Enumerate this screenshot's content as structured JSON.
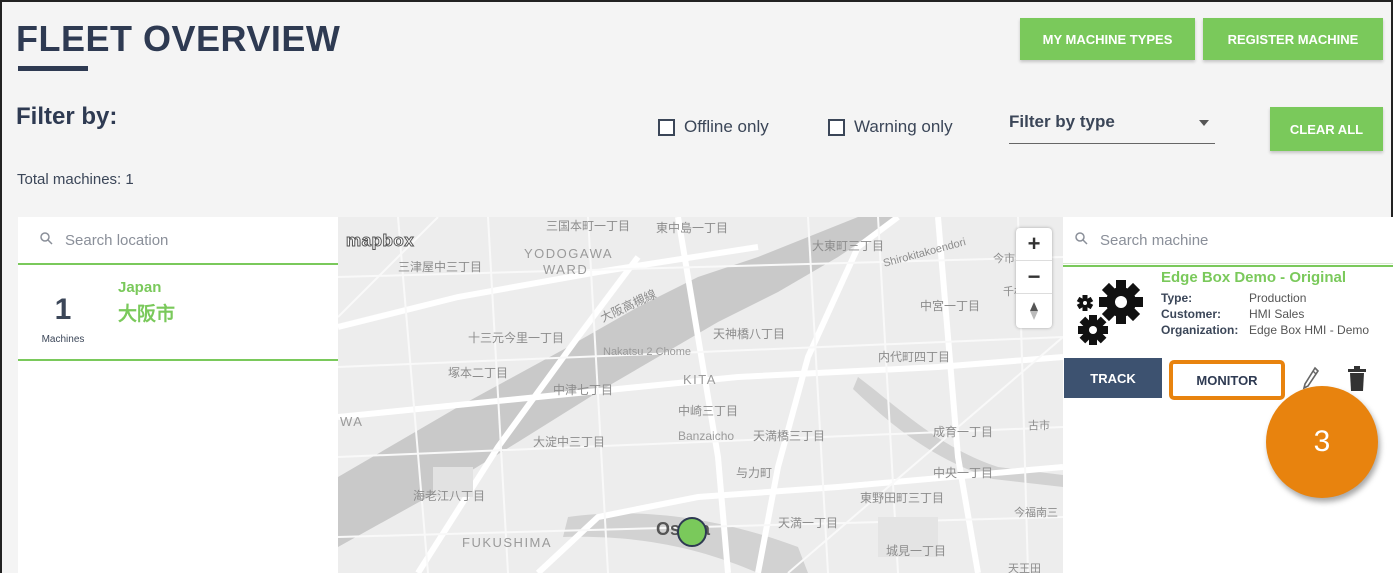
{
  "header": {
    "title": "FLEET OVERVIEW",
    "my_machine_types_label": "MY MACHINE TYPES",
    "register_machine_label": "REGISTER MACHINE"
  },
  "filters": {
    "heading": "Filter by:",
    "offline_only_label": "Offline only",
    "offline_only_checked": false,
    "warning_only_label": "Warning only",
    "warning_only_checked": false,
    "type_placeholder": "Filter by type",
    "clear_all_label": "CLEAR ALL"
  },
  "summary": {
    "total_machines": "Total machines: 1"
  },
  "location_panel": {
    "search_placeholder": "Search location",
    "items": [
      {
        "count": "1",
        "count_label": "Machines",
        "country": "Japan",
        "city": "大阪市"
      }
    ]
  },
  "map": {
    "provider_logo": "mapbox",
    "labels": [
      "三国本町一丁目",
      "東中島一丁目",
      "YODOGAWA",
      "WARD",
      "三津屋中三丁目",
      "大阪高槻線",
      "大東町三丁目",
      "Shirokitakoendori",
      "中宮一丁目",
      "十三元今里一丁目",
      "天神橋八丁目",
      "Nakatsu 2 Chome",
      "内代町四丁目",
      "塚本二丁目",
      "中津七丁目",
      "KITA",
      "中崎三丁目",
      "大淀中三丁目",
      "Banzaicho",
      "天満橋三丁目",
      "成育一丁目",
      "与力町",
      "中央一丁目",
      "海老江八丁目",
      "東野田町三丁目",
      "天満一丁目",
      "FUKUSHIMA",
      "城見一丁目",
      "Osaka",
      "WA",
      "今市",
      "古市",
      "今福南三",
      "天王田",
      "千林"
    ],
    "zoom_in_label": "+",
    "zoom_out_label": "−",
    "marker_status_color": "#7ac95b"
  },
  "machine_panel": {
    "search_placeholder": "Search machine",
    "machines": [
      {
        "name": "Edge Box Demo - Original",
        "type_key": "Type:",
        "type_value": "Production",
        "customer_key": "Customer:",
        "customer_value": "HMI Sales",
        "organization_key": "Organization:",
        "organization_value": "Edge Box HMI - Demo",
        "icon": "gears-icon",
        "track_label": "TRACK",
        "monitor_label": "MONITOR"
      }
    ]
  },
  "annotation": {
    "step_number": "3",
    "highlight_color": "#e8830e"
  },
  "colors": {
    "accent_green": "#7ac95b",
    "navy": "#2e3a52",
    "track_blue": "#3d5270"
  }
}
